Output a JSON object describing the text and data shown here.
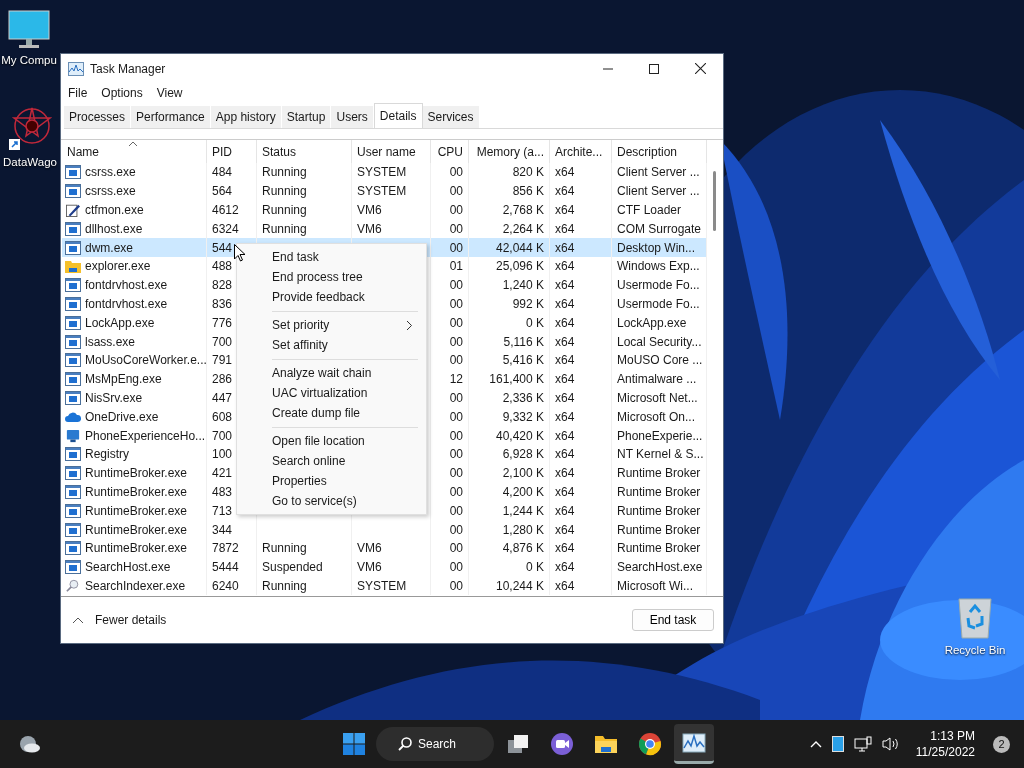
{
  "desktop_icons": [
    {
      "label": "My Compu",
      "kind": "computer"
    },
    {
      "label": "DataWago",
      "kind": "star"
    },
    {
      "label": "Recycle Bin",
      "kind": "bin"
    }
  ],
  "window": {
    "title": "Task Manager"
  },
  "menu_bar": [
    "File",
    "Options",
    "View"
  ],
  "tabs": [
    {
      "label": "Processes",
      "selected": false
    },
    {
      "label": "Performance",
      "selected": false
    },
    {
      "label": "App history",
      "selected": false
    },
    {
      "label": "Startup",
      "selected": false
    },
    {
      "label": "Users",
      "selected": false
    },
    {
      "label": "Details",
      "selected": true
    },
    {
      "label": "Services",
      "selected": false
    }
  ],
  "table": {
    "columns": [
      "Name",
      "PID",
      "Status",
      "User name",
      "CPU",
      "Memory (a...",
      "Archite...",
      "Description"
    ],
    "rows": [
      {
        "kind": "app",
        "name": "csrss.exe",
        "pid": "484",
        "status": "Running",
        "user": "SYSTEM",
        "cpu": "00",
        "memory": "820 K",
        "arch": "x64",
        "description": "Client Server ...",
        "selected": false
      },
      {
        "kind": "app",
        "name": "csrss.exe",
        "pid": "564",
        "status": "Running",
        "user": "SYSTEM",
        "cpu": "00",
        "memory": "856 K",
        "arch": "x64",
        "description": "Client Server ...",
        "selected": false
      },
      {
        "kind": "pen",
        "name": "ctfmon.exe",
        "pid": "4612",
        "status": "Running",
        "user": "VM6",
        "cpu": "00",
        "memory": "2,768 K",
        "arch": "x64",
        "description": "CTF Loader",
        "selected": false
      },
      {
        "kind": "app",
        "name": "dllhost.exe",
        "pid": "6324",
        "status": "Running",
        "user": "VM6",
        "cpu": "00",
        "memory": "2,264 K",
        "arch": "x64",
        "description": "COM Surrogate",
        "selected": false
      },
      {
        "kind": "app",
        "name": "dwm.exe",
        "pid": "544",
        "cpu": "00",
        "memory": "42,044 K",
        "arch": "x64",
        "description": "Desktop Win...",
        "selected": true
      },
      {
        "kind": "folder",
        "name": "explorer.exe",
        "pid": "488",
        "cpu": "01",
        "memory": "25,096 K",
        "arch": "x64",
        "description": "Windows Exp...",
        "selected": false
      },
      {
        "kind": "app",
        "name": "fontdrvhost.exe",
        "pid": "828",
        "cpu": "00",
        "memory": "1,240 K",
        "arch": "x64",
        "description": "Usermode Fo...",
        "selected": false
      },
      {
        "kind": "app",
        "name": "fontdrvhost.exe",
        "pid": "836",
        "cpu": "00",
        "memory": "992 K",
        "arch": "x64",
        "description": "Usermode Fo...",
        "selected": false
      },
      {
        "kind": "app",
        "name": "LockApp.exe",
        "pid": "776",
        "cpu": "00",
        "memory": "0 K",
        "arch": "x64",
        "description": "LockApp.exe",
        "selected": false
      },
      {
        "kind": "app",
        "name": "lsass.exe",
        "pid": "700",
        "cpu": "00",
        "memory": "5,116 K",
        "arch": "x64",
        "description": "Local Security...",
        "selected": false
      },
      {
        "kind": "app",
        "name": "MoUsoCoreWorker.e...",
        "pid": "791",
        "cpu": "00",
        "memory": "5,416 K",
        "arch": "x64",
        "description": "MoUSO Core ...",
        "selected": false
      },
      {
        "kind": "app",
        "name": "MsMpEng.exe",
        "pid": "286",
        "cpu": "12",
        "memory": "161,400 K",
        "arch": "x64",
        "description": "Antimalware ...",
        "selected": false
      },
      {
        "kind": "app",
        "name": "NisSrv.exe",
        "pid": "447",
        "cpu": "00",
        "memory": "2,336 K",
        "arch": "x64",
        "description": "Microsoft Net...",
        "selected": false
      },
      {
        "kind": "cloud",
        "name": "OneDrive.exe",
        "pid": "608",
        "cpu": "00",
        "memory": "9,332 K",
        "arch": "x64",
        "description": "Microsoft On...",
        "selected": false
      },
      {
        "kind": "phone",
        "name": "PhoneExperienceHo...",
        "pid": "700",
        "cpu": "00",
        "memory": "40,420 K",
        "arch": "x64",
        "description": "PhoneExperie...",
        "selected": false
      },
      {
        "kind": "app",
        "name": "Registry",
        "pid": "100",
        "cpu": "00",
        "memory": "6,928 K",
        "arch": "x64",
        "description": "NT Kernel & S...",
        "selected": false
      },
      {
        "kind": "app",
        "name": "RuntimeBroker.exe",
        "pid": "421",
        "cpu": "00",
        "memory": "2,100 K",
        "arch": "x64",
        "description": "Runtime Broker",
        "selected": false
      },
      {
        "kind": "app",
        "name": "RuntimeBroker.exe",
        "pid": "483",
        "cpu": "00",
        "memory": "4,200 K",
        "arch": "x64",
        "description": "Runtime Broker",
        "selected": false
      },
      {
        "kind": "app",
        "name": "RuntimeBroker.exe",
        "pid": "713",
        "cpu": "00",
        "memory": "1,244 K",
        "arch": "x64",
        "description": "Runtime Broker",
        "selected": false
      },
      {
        "kind": "app",
        "name": "RuntimeBroker.exe",
        "pid": "344",
        "cpu": "00",
        "memory": "1,280 K",
        "arch": "x64",
        "description": "Runtime Broker",
        "selected": false
      },
      {
        "kind": "app",
        "name": "RuntimeBroker.exe",
        "pid": "7872",
        "status": "Running",
        "user": "VM6",
        "cpu": "00",
        "memory": "4,876 K",
        "arch": "x64",
        "description": "Runtime Broker",
        "selected": false
      },
      {
        "kind": "app",
        "name": "SearchHost.exe",
        "pid": "5444",
        "status": "Suspended",
        "user": "VM6",
        "cpu": "00",
        "memory": "0 K",
        "arch": "x64",
        "description": "SearchHost.exe",
        "selected": false
      },
      {
        "kind": "search",
        "name": "SearchIndexer.exe",
        "pid": "6240",
        "status": "Running",
        "user": "SYSTEM",
        "cpu": "00",
        "memory": "10,244 K",
        "arch": "x64",
        "description": "Microsoft Wi...",
        "selected": false
      }
    ]
  },
  "context_menu": {
    "groups": [
      [
        {
          "label": "End task",
          "submenu": false
        },
        {
          "label": "End process tree",
          "submenu": false
        },
        {
          "label": "Provide feedback",
          "submenu": false
        }
      ],
      [
        {
          "label": "Set priority",
          "submenu": true
        },
        {
          "label": "Set affinity",
          "submenu": false
        }
      ],
      [
        {
          "label": "Analyze wait chain",
          "submenu": false
        },
        {
          "label": "UAC virtualization",
          "submenu": false
        },
        {
          "label": "Create dump file",
          "submenu": false
        }
      ],
      [
        {
          "label": "Open file location",
          "submenu": false
        },
        {
          "label": "Search online",
          "submenu": false
        },
        {
          "label": "Properties",
          "submenu": false
        },
        {
          "label": "Go to service(s)",
          "submenu": false
        }
      ]
    ]
  },
  "footer": {
    "toggle": "Fewer details",
    "button": "End task"
  },
  "taskbar": {
    "search": "Search",
    "apps": [
      {
        "kind": "taskview",
        "active": false
      },
      {
        "kind": "chat",
        "active": false
      },
      {
        "kind": "folder",
        "active": false
      },
      {
        "kind": "browser",
        "active": false
      },
      {
        "kind": "taskmanager",
        "active": true
      }
    ],
    "time": "1:13 PM",
    "date": "11/25/2022",
    "notifications": "2"
  }
}
